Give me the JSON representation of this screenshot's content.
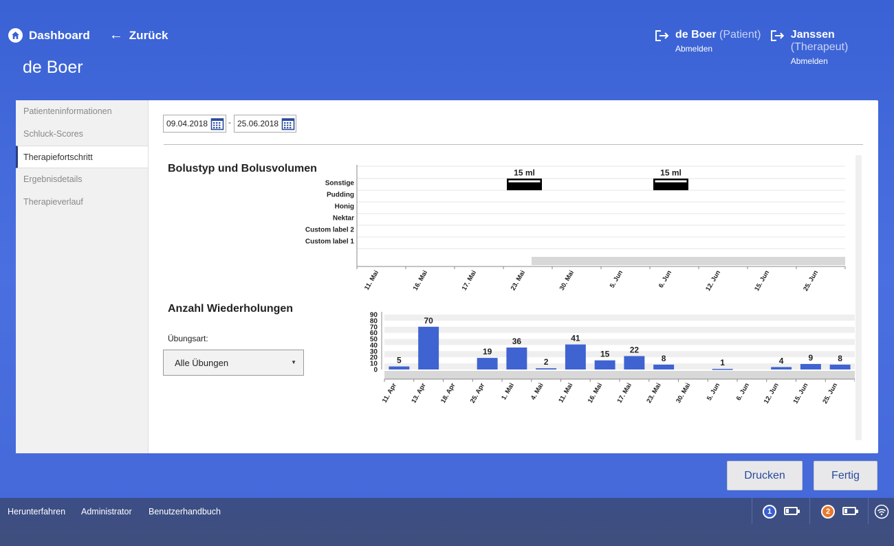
{
  "nav": {
    "dashboard_label": "Dashboard",
    "back_label": "Zurück"
  },
  "page": {
    "title": "de Boer"
  },
  "users": [
    {
      "name": "de Boer",
      "role": "(Patient)",
      "action": "Abmelden"
    },
    {
      "name": "Janssen",
      "role": "(Therapeut)",
      "action": "Abmelden"
    }
  ],
  "sidebar": {
    "items": [
      {
        "label": "Patienteninformationen"
      },
      {
        "label": "Schluck-Scores"
      },
      {
        "label": "Therapiefortschritt"
      },
      {
        "label": "Ergebnisdetails"
      },
      {
        "label": "Therapieverlauf"
      }
    ],
    "active_index": 2
  },
  "filters": {
    "date_from": "09.04.2018",
    "date_sep": "-",
    "date_to": "25.06.2018"
  },
  "sections": {
    "bolus_title": "Bolustyp und Bolusvolumen",
    "reps_title": "Anzahl Wiederholungen",
    "exercise_label": "Übungsart:",
    "exercise_value": "Alle Übungen"
  },
  "chart_data": [
    {
      "type": "scatter",
      "title": "Bolustyp und Bolusvolumen",
      "categories": [
        "Sonstige",
        "Pudding",
        "Honig",
        "Nektar",
        "Custom label 2",
        "Custom label 1"
      ],
      "x": [
        "11. Mai",
        "16. Mai",
        "17. Mai",
        "23. Mai",
        "30. Mai",
        "5. Jun",
        "6. Jun",
        "12. Jun",
        "15. Jun",
        "25. Jun"
      ],
      "points": [
        {
          "x": "23. Mai",
          "category": "Sonstige",
          "label": "15 ml"
        },
        {
          "x": "6. Jun",
          "category": "Sonstige",
          "label": "15 ml"
        }
      ]
    },
    {
      "type": "bar",
      "title": "Anzahl Wiederholungen",
      "categories": [
        "11. Apr",
        "13. Apr",
        "18. Apr",
        "25. Apr",
        "1. Mai",
        "4. Mai",
        "11. Mai",
        "16. Mai",
        "17. Mai",
        "23. Mai",
        "30. Mai",
        "5. Jun",
        "6. Jun",
        "12. Jun",
        "15. Jun",
        "25. Jun"
      ],
      "values": [
        5,
        70,
        null,
        19,
        36,
        2,
        41,
        15,
        22,
        8,
        null,
        1,
        null,
        4,
        9,
        8
      ],
      "ylim": [
        0,
        90
      ],
      "yticks": [
        0,
        10,
        20,
        30,
        40,
        50,
        60,
        70,
        80,
        90
      ],
      "color": "#3f63d1"
    }
  ],
  "buttons": {
    "print_label": "Drucken",
    "done_label": "Fertig"
  },
  "footer": {
    "shutdown_label": "Herunterfahren",
    "admin_label": "Administrator",
    "manual_label": "Benutzerhandbuch",
    "device1": "1",
    "device2": "2"
  }
}
